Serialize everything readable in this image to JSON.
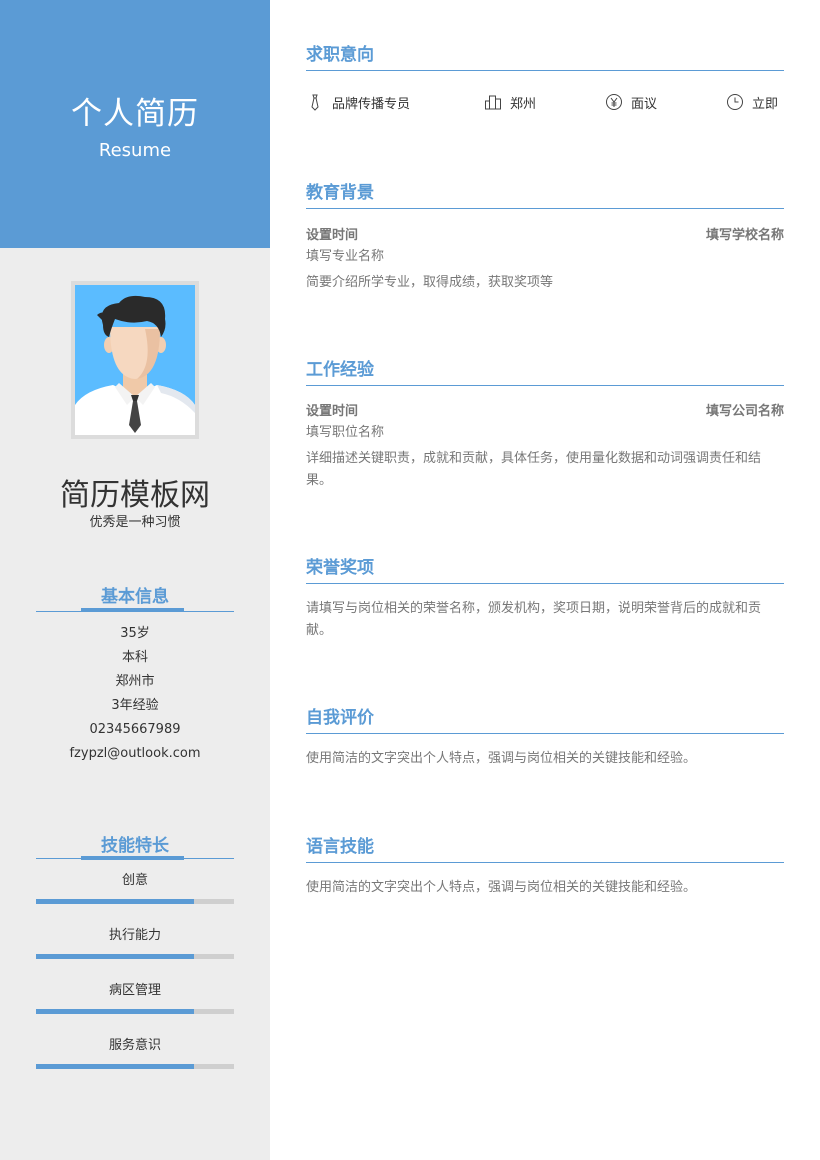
{
  "header": {
    "title": "个人简历",
    "subtitle": "Resume"
  },
  "profile": {
    "name": "简历模板网",
    "tagline": "优秀是一种习惯"
  },
  "basic_info": {
    "title": "基本信息",
    "items": [
      "35岁",
      "本科",
      "郑州市",
      "3年经验",
      "02345667989",
      "fzypzl@outlook.com"
    ]
  },
  "skills": {
    "title": "技能特长",
    "items": [
      {
        "name": "创意",
        "level": 0.8
      },
      {
        "name": "执行能力",
        "level": 0.8
      },
      {
        "name": "病区管理",
        "level": 0.8
      },
      {
        "name": "服务意识",
        "level": 0.8
      }
    ]
  },
  "job_intent": {
    "title": "求职意向",
    "items": [
      {
        "icon": "tie-icon",
        "text": "品牌传播专员"
      },
      {
        "icon": "city-icon",
        "text": "郑州"
      },
      {
        "icon": "yen-icon",
        "text": "面议"
      },
      {
        "icon": "clock-icon",
        "text": "立即"
      }
    ]
  },
  "education": {
    "title": "教育背景",
    "time": "设置时间",
    "school": "填写学校名称",
    "major": "填写专业名称",
    "desc": "简要介绍所学专业，取得成绩，获取奖项等"
  },
  "work": {
    "title": "工作经验",
    "time": "设置时间",
    "company": "填写公司名称",
    "position": "填写职位名称",
    "desc": "详细描述关键职责，成就和贡献，具体任务，使用量化数据和动词强调责任和结果。"
  },
  "honors": {
    "title": "荣誉奖项",
    "desc": "请填写与岗位相关的荣誉名称，颁发机构，奖项日期，说明荣誉背后的成就和贡献。"
  },
  "self_eval": {
    "title": "自我评价",
    "desc": "使用简洁的文字突出个人特点，强调与岗位相关的关键技能和经验。"
  },
  "language": {
    "title": "语言技能",
    "desc": "使用简洁的文字突出个人特点，强调与岗位相关的关键技能和经验。"
  },
  "colors": {
    "accent": "#5b9bd5",
    "sidebar_bg": "#ededed",
    "photo_bg": "#5bbcff"
  }
}
